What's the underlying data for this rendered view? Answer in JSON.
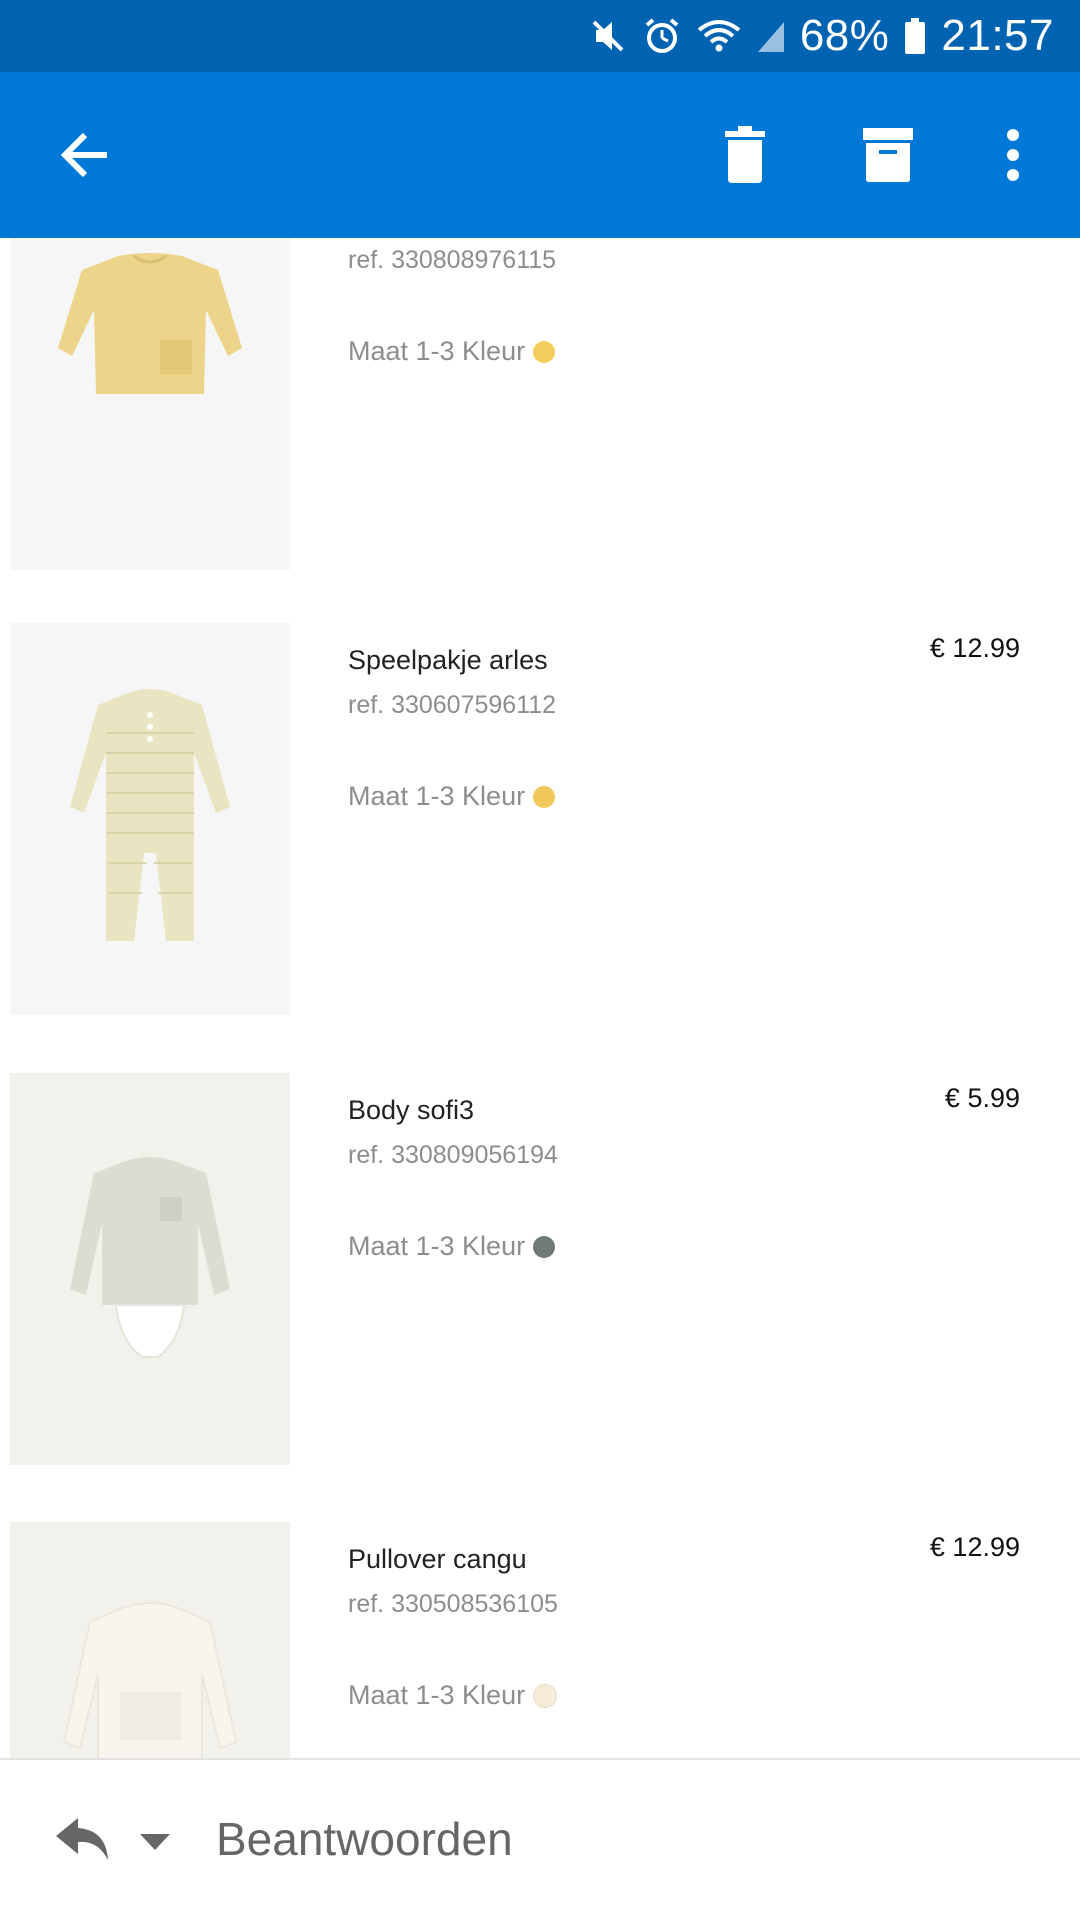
{
  "status_bar": {
    "battery": "68%",
    "time": "21:57",
    "icons": [
      "mute-icon",
      "alarm-icon",
      "wifi-icon",
      "signal-icon",
      "battery-icon"
    ]
  },
  "app_bar": {
    "icons": [
      "back-arrow-icon",
      "trash-icon",
      "archive-icon",
      "more-vert-icon"
    ]
  },
  "products": [
    {
      "name": "",
      "ref": "ref. 330808976115",
      "meta": "Maat 1-3 Kleur",
      "color": "#f2cf5c",
      "price": ""
    },
    {
      "name": "Speelpakje arles",
      "ref": "ref. 330607596112",
      "meta": "Maat 1-3 Kleur",
      "color": "#f0c95a",
      "price": "€ 12.99"
    },
    {
      "name": "Body sofi3",
      "ref": "ref. 330809056194",
      "meta": "Maat 1-3 Kleur",
      "color": "#727a78",
      "price": "€ 5.99"
    },
    {
      "name": "Pullover cangu",
      "ref": "ref. 330508536105",
      "meta": "Maat 1-3 Kleur",
      "color": "#f6ecd8",
      "price": "€ 12.99"
    }
  ],
  "bottom_bar": {
    "reply_label": "Beantwoorden",
    "icons": [
      "reply-icon",
      "chevron-down-icon"
    ]
  },
  "colors": {
    "status_bar": "#0063b1",
    "app_bar": "#0078d7"
  }
}
